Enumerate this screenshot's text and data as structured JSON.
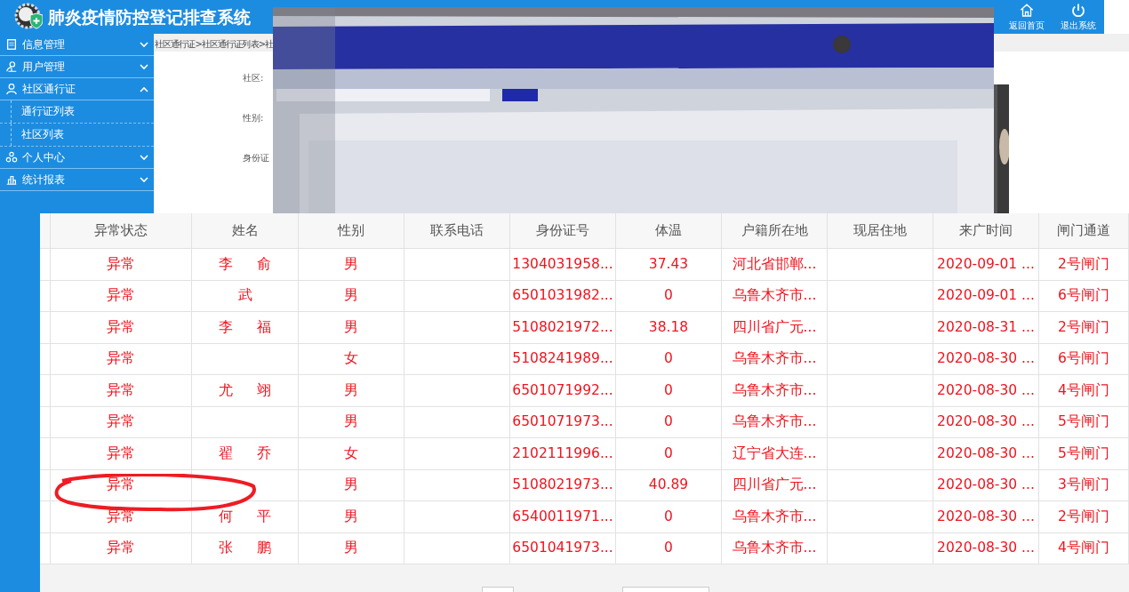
{
  "header": {
    "title": "肺炎疫情防控登记排查系统",
    "actions": [
      {
        "label": "返回首页",
        "kind": "home"
      },
      {
        "label": "退出系统",
        "kind": "power"
      }
    ]
  },
  "sidebar": {
    "items": [
      {
        "label": "信息管理",
        "kind": "doc",
        "expanded": false
      },
      {
        "label": "用户管理",
        "kind": "users",
        "expanded": false
      },
      {
        "label": "社区通行证",
        "kind": "person",
        "expanded": true,
        "children": [
          {
            "label": "通行证列表"
          },
          {
            "label": "社区列表"
          }
        ]
      },
      {
        "label": "个人中心",
        "kind": "group",
        "expanded": false
      },
      {
        "label": "统计报表",
        "kind": "chart",
        "expanded": false
      }
    ]
  },
  "breadcrumb": "社区通行证>社区通行证列表>社",
  "form_labels": [
    "社区:",
    "性别:",
    "身份证"
  ],
  "table": {
    "columns": [
      "异常状态",
      "姓名",
      "性别",
      "联系电话",
      "身份证号",
      "体温",
      "户籍所在地",
      "现居住地",
      "来广时间",
      "闸门通道"
    ],
    "rows": [
      {
        "status": "异常",
        "name": "李 俞",
        "gender": "男",
        "id": "1304031958...",
        "temp": "37.43",
        "hukou": "河北省邯郸...",
        "time": "2020-09-01 ...",
        "gate": "2号闸门",
        "circled": false
      },
      {
        "status": "异常",
        "name": "武",
        "gender": "男",
        "id": "6501031982...",
        "temp": "0",
        "hukou": "乌鲁木齐市...",
        "time": "2020-09-01 ...",
        "gate": "6号闸门",
        "circled": false
      },
      {
        "status": "异常",
        "name": "李 福",
        "gender": "男",
        "id": "5108021972...",
        "temp": "38.18",
        "hukou": "四川省广元...",
        "time": "2020-08-31 ...",
        "gate": "2号闸门",
        "circled": false
      },
      {
        "status": "异常",
        "gender": "女",
        "id": "5108241989...",
        "temp": "0",
        "hukou": "乌鲁木齐市...",
        "time": "2020-08-30 ...",
        "gate": "6号闸门",
        "circled": false
      },
      {
        "status": "异常",
        "name": "尤 翊",
        "gender": "男",
        "id": "6501071992...",
        "temp": "0",
        "hukou": "乌鲁木齐市...",
        "time": "2020-08-30 ...",
        "gate": "4号闸门",
        "circled": false
      },
      {
        "status": "异常",
        "gender": "男",
        "id": "6501071973...",
        "temp": "0",
        "hukou": "乌鲁木齐市...",
        "time": "2020-08-30 ...",
        "gate": "5号闸门",
        "circled": false
      },
      {
        "status": "异常",
        "name": "翟 乔",
        "gender": "女",
        "id": "2102111996...",
        "temp": "0",
        "hukou": "辽宁省大连...",
        "time": "2020-08-30 ...",
        "gate": "5号闸门",
        "circled": false
      },
      {
        "status": "异常",
        "gender": "男",
        "id": "5108021973...",
        "temp": "40.89",
        "hukou": "四川省广元...",
        "time": "2020-08-30 ...",
        "gate": "3号闸门",
        "circled": true
      },
      {
        "status": "异常",
        "name": "何 平",
        "gender": "男",
        "id": "6540011971...",
        "temp": "0",
        "hukou": "乌鲁木齐市...",
        "time": "2020-08-30 ...",
        "gate": "2号闸门",
        "circled": false
      },
      {
        "status": "异常",
        "name": "张 鹏",
        "gender": "男",
        "id": "6501041973...",
        "temp": "0",
        "hukou": "乌鲁木齐市...",
        "time": "2020-08-30 ...",
        "gate": "4号闸门",
        "circled": false
      }
    ]
  }
}
